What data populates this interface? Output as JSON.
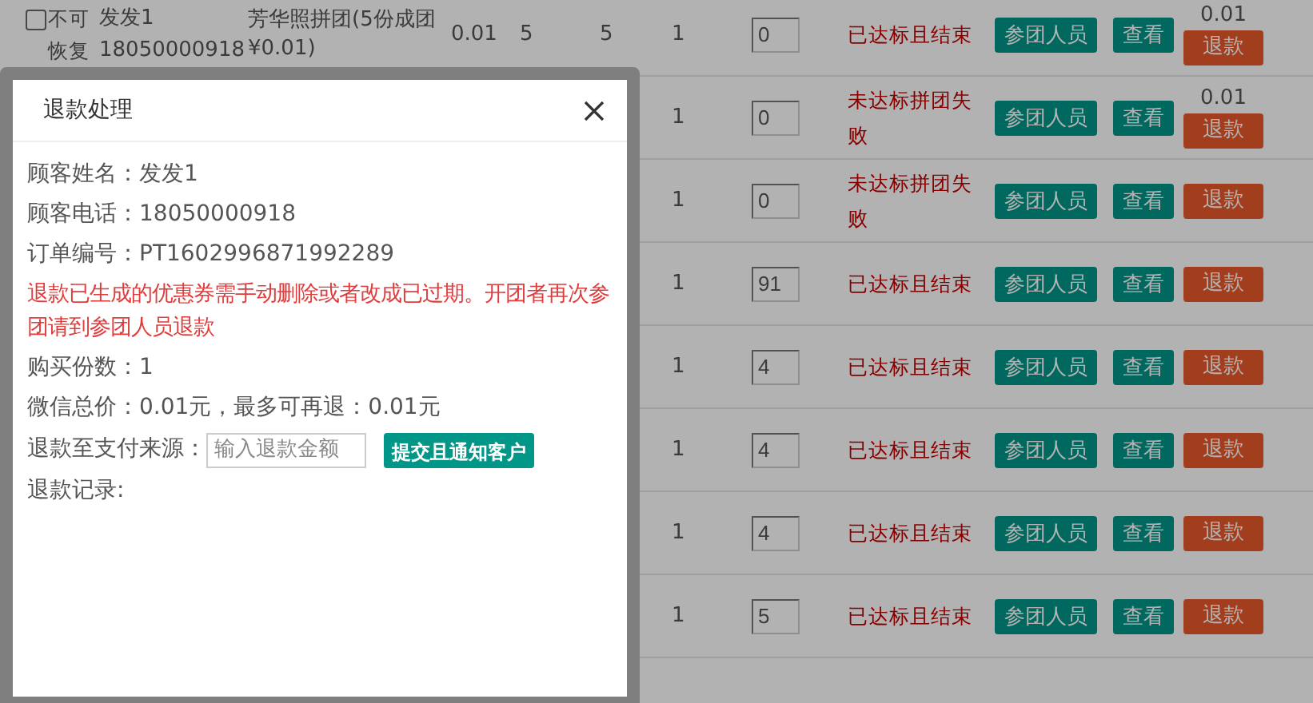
{
  "table": {
    "rows": [
      {
        "select": {
          "checked": false
        },
        "status_note": "不可恢复",
        "customer_name": "发发1",
        "customer_phone": "18050000918",
        "product": "芳华照拼团(5份成团¥0.01)",
        "price": "0.01",
        "column_5": "5",
        "column_6": "5",
        "quantity": "1",
        "count_value": "0",
        "group_status": "已达标且结束",
        "members_button": "参团人员",
        "view_button": "查看",
        "refund_amount": "0.01",
        "refund_button": "退款"
      },
      {
        "quantity": "1",
        "count_value": "0",
        "group_status": "未达标拼团失败",
        "members_button": "参团人员",
        "view_button": "查看",
        "refund_amount": "0.01",
        "refund_button": "退款"
      },
      {
        "quantity": "1",
        "count_value": "0",
        "group_status": "未达标拼团失败",
        "members_button": "参团人员",
        "view_button": "查看",
        "refund_button": "退款"
      },
      {
        "quantity": "1",
        "count_value": "91",
        "group_status": "已达标且结束",
        "members_button": "参团人员",
        "view_button": "查看",
        "refund_button": "退款"
      },
      {
        "quantity": "1",
        "count_value": "4",
        "group_status": "已达标且结束",
        "members_button": "参团人员",
        "view_button": "查看",
        "refund_button": "退款"
      },
      {
        "quantity": "1",
        "count_value": "4",
        "group_status": "已达标且结束",
        "members_button": "参团人员",
        "view_button": "查看",
        "refund_button": "退款"
      },
      {
        "quantity": "1",
        "count_value": "4",
        "group_status": "已达标且结束",
        "members_button": "参团人员",
        "view_button": "查看",
        "refund_button": "退款"
      },
      {
        "quantity": "1",
        "count_value": "5",
        "group_status": "已达标且结束",
        "members_button": "参团人员",
        "view_button": "查看",
        "refund_button": "退款"
      }
    ]
  },
  "dialog": {
    "title": "退款处理",
    "lines": [
      {
        "kind": "info",
        "text": "顾客姓名：发发1"
      },
      {
        "kind": "info",
        "text": "顾客电话：18050000918"
      },
      {
        "kind": "info",
        "text": "订单编号：PT1602996871992289"
      },
      {
        "kind": "warning",
        "text": "退款已生成的优惠券需手动删除或者改成已过期。开团者再次参团请到参团人员退款"
      },
      {
        "kind": "info",
        "text": "购买份数：1"
      },
      {
        "kind": "info",
        "text": "微信总价：0.01元，最多可再退：0.01元"
      }
    ],
    "refund_label": "退款至支付来源：",
    "amount_field": {
      "placeholder": "输入退款金额"
    },
    "submit_button": "提交且通知客户",
    "record_label": "退款记录:"
  }
}
